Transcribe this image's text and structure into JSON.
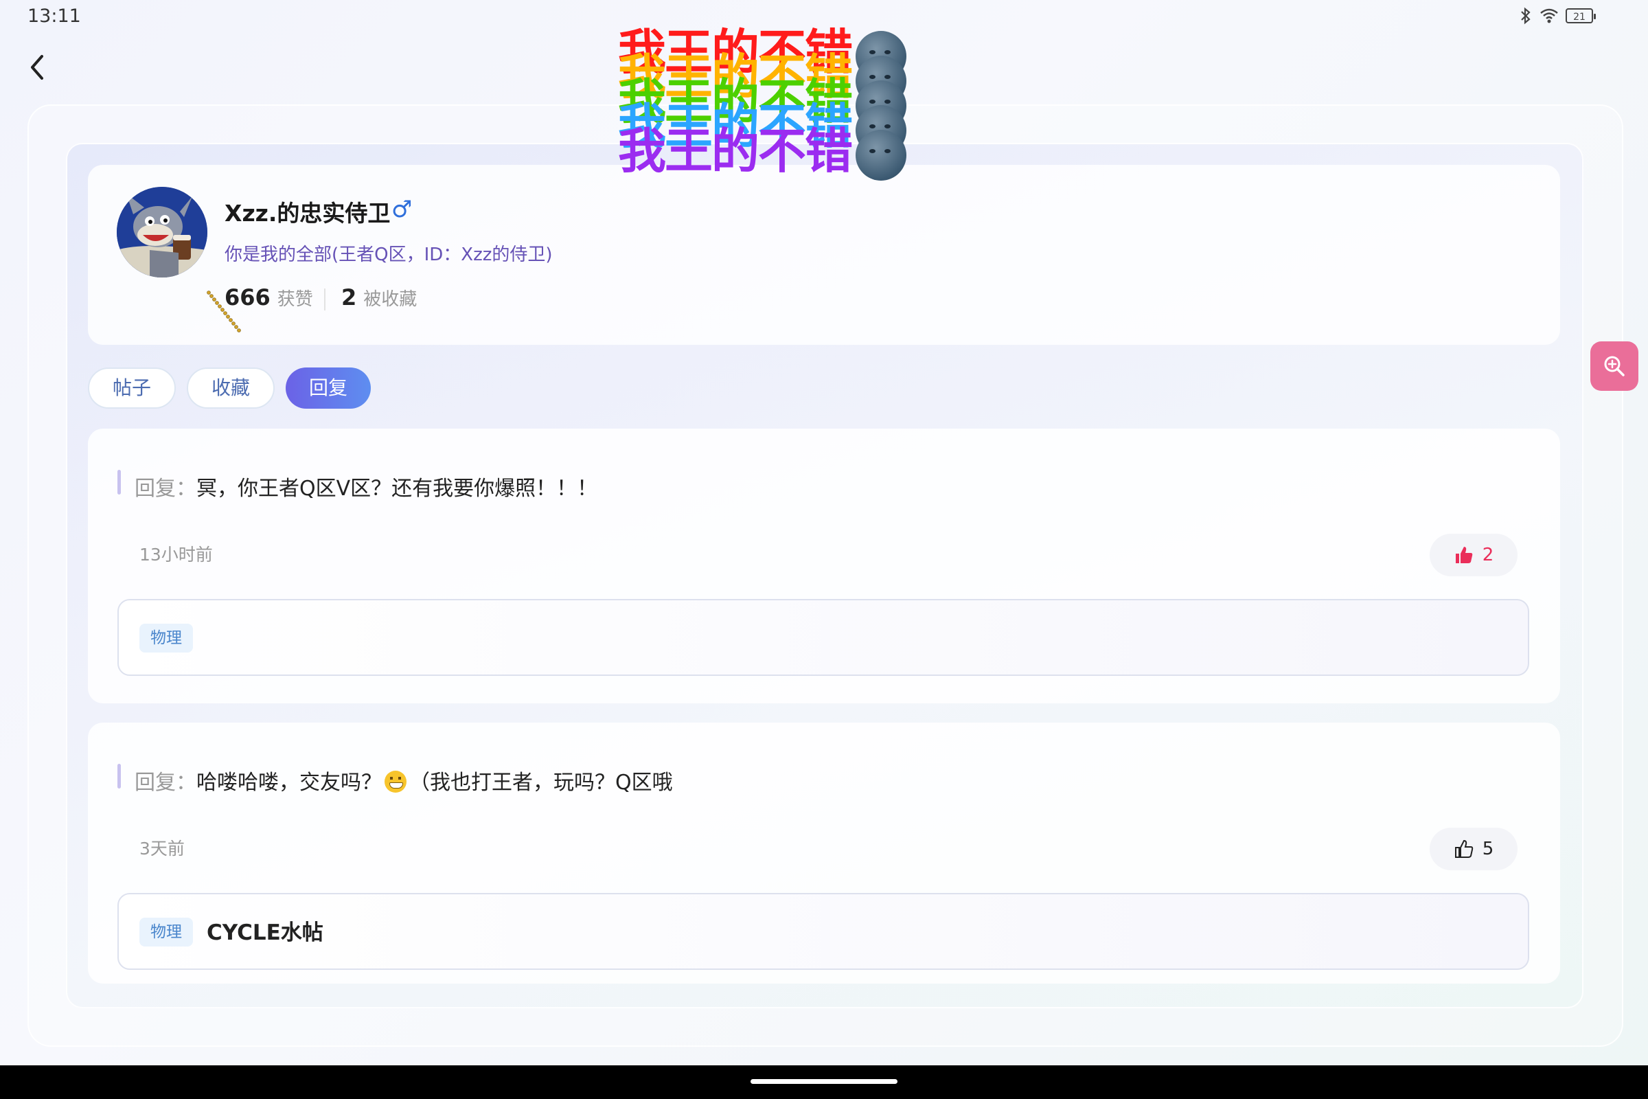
{
  "status_bar": {
    "time": "13:11",
    "battery_level": "21"
  },
  "banner": {
    "text": "我王的不错",
    "line_colors": [
      "#ff1b1b",
      "#ffb300",
      "#4cd000",
      "#2ba5ff",
      "#9b2cf0"
    ],
    "emoji_icon": "moon-face-icon"
  },
  "profile": {
    "username": "Xzz.的忠实侍卫",
    "gender_symbol": "♂",
    "signature": "你是我的全部(王者Q区，ID：Xzz的侍卫)",
    "likes_count": "666",
    "likes_label": "获赞",
    "favorited_count": "2",
    "favorited_label": "被收藏"
  },
  "tabs": [
    {
      "label": "帖子",
      "active": false
    },
    {
      "label": "收藏",
      "active": false
    },
    {
      "label": "回复",
      "active": true
    }
  ],
  "replies": [
    {
      "prefix": "回复：",
      "content": "冥，你王者Q区V区？还有我要你爆照！！！",
      "time": "13小时前",
      "likes": "2",
      "liked": true,
      "post_tag": "物理",
      "post_title": ""
    },
    {
      "prefix": "回复：",
      "content_before_emoji": "哈喽哈喽，交友吗？",
      "emoji": "grinning-face-icon",
      "content_after_emoji": "（我也打王者，玩吗？Q区哦",
      "time": "3天前",
      "likes": "5",
      "liked": false,
      "post_tag": "物理",
      "post_title": "CYCLE水帖"
    }
  ],
  "colors": {
    "accent": "#6b62e6",
    "like_active": "#ea2e5a",
    "zoom_button": "#ea6e99",
    "signature": "#6652b6"
  }
}
